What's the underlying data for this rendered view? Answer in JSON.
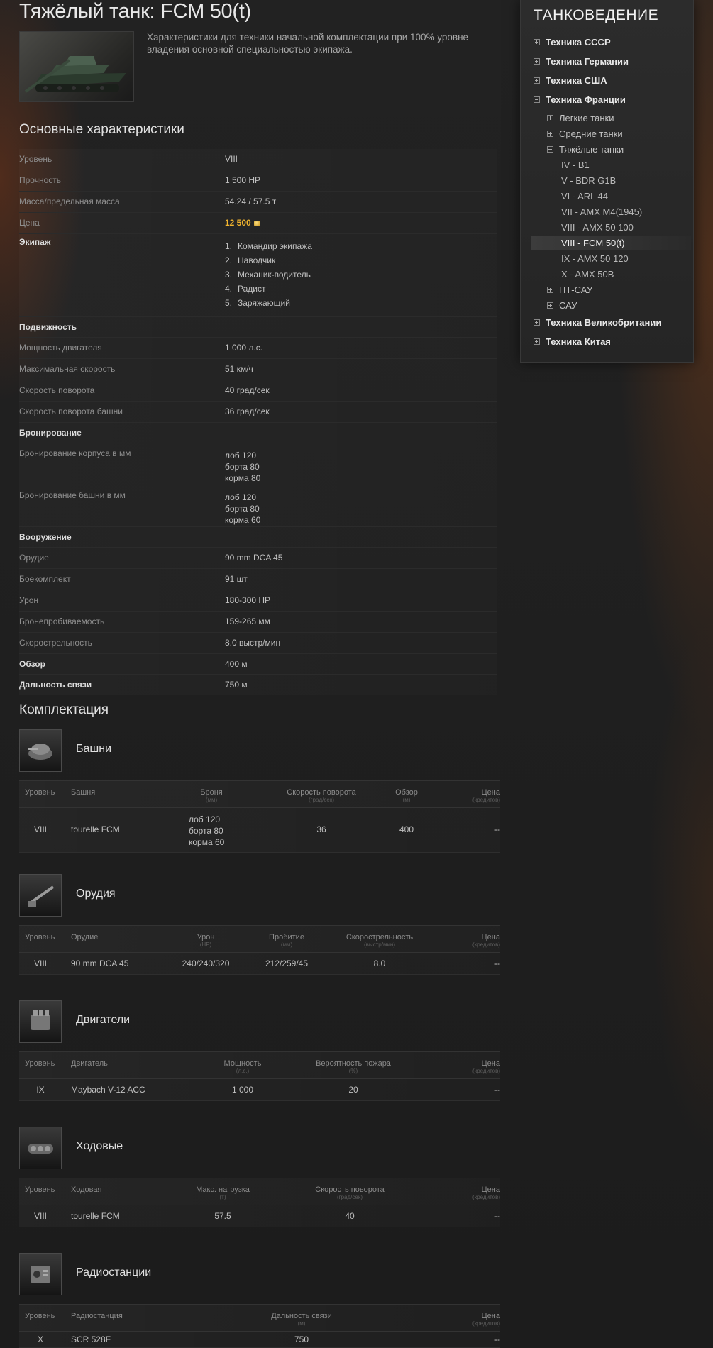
{
  "header": {
    "title": "Тяжёлый танк: FCM 50(t)",
    "description": "Характеристики для техники начальной комплектации при 100% уровне владения основной специальностью экипажа."
  },
  "specs": {
    "section_title": "Основные характеристики",
    "level_label": "Уровень",
    "level_value": "VIII",
    "hp_label": "Прочность",
    "hp_value": "1 500 HP",
    "mass_label": "Масса/предельная масса",
    "mass_value": "54.24 / 57.5 т",
    "price_label": "Цена",
    "price_value": "12 500",
    "crew_label": "Экипаж",
    "crew": [
      {
        "num": "1.",
        "role": "Командир экипажа"
      },
      {
        "num": "2.",
        "role": "Наводчик"
      },
      {
        "num": "3.",
        "role": "Механик-водитель"
      },
      {
        "num": "4.",
        "role": "Радист"
      },
      {
        "num": "5.",
        "role": "Заряжающий"
      }
    ],
    "mobility_label": "Подвижность",
    "engine_power_label": "Мощность двигателя",
    "engine_power_value": "1 000 л.с.",
    "max_speed_label": "Максимальная скорость",
    "max_speed_value": "51 км/ч",
    "traverse_label": "Скорость поворота",
    "traverse_value": "40 град/сек",
    "turret_traverse_label": "Скорость поворота башни",
    "turret_traverse_value": "36 град/сек",
    "armor_label": "Бронирование",
    "hull_armor_label": "Бронирование корпуса в мм",
    "hull_armor": [
      "лоб 120",
      "борта 80",
      "корма 80"
    ],
    "turret_armor_label": "Бронирование башни в мм",
    "turret_armor": [
      "лоб 120",
      "борта 80",
      "корма 60"
    ],
    "armament_label": "Вооружение",
    "gun_label": "Орудие",
    "gun_value": "90 mm DCA 45",
    "ammo_label": "Боекомплект",
    "ammo_value": "91 шт",
    "damage_label": "Урон",
    "damage_value": "180-300 HP",
    "penetration_label": "Бронепробиваемость",
    "penetration_value": "159-265 мм",
    "rof_label": "Скорострельность",
    "rof_value": "8.0 выстр/мин",
    "view_label": "Обзор",
    "view_value": "400 м",
    "radio_range_label": "Дальность связи",
    "radio_range_value": "750 м"
  },
  "equipment": {
    "section_title": "Комплектация",
    "turrets": {
      "title": "Башни",
      "headers": {
        "level": "Уровень",
        "name": "Башня",
        "armor": "Броня",
        "armor_unit": "(мм)",
        "traverse": "Скорость поворота",
        "traverse_unit": "(град/сек)",
        "view": "Обзор",
        "view_unit": "(м)",
        "price": "Цена",
        "price_unit": "(кредитов)"
      },
      "rows": [
        {
          "level": "VIII",
          "name": "tourelle FCM",
          "armor": [
            "лоб 120",
            "борта 80",
            "корма 60"
          ],
          "traverse": "36",
          "view": "400",
          "price": "--"
        }
      ]
    },
    "guns": {
      "title": "Орудия",
      "headers": {
        "level": "Уровень",
        "name": "Орудие",
        "damage": "Урон",
        "damage_unit": "(HP)",
        "penetration": "Пробитие",
        "penetration_unit": "(мм)",
        "rof": "Скорострельность",
        "rof_unit": "(выстр/мин)",
        "price": "Цена",
        "price_unit": "(кредитов)"
      },
      "rows": [
        {
          "level": "VIII",
          "name": "90 mm DCA 45",
          "damage": "240/240/320",
          "penetration": "212/259/45",
          "rof": "8.0",
          "price": "--"
        }
      ]
    },
    "engines": {
      "title": "Двигатели",
      "headers": {
        "level": "Уровень",
        "name": "Двигатель",
        "power": "Мощность",
        "power_unit": "(л.с.)",
        "fire": "Вероятность пожара",
        "fire_unit": "(%)",
        "price": "Цена",
        "price_unit": "(кредитов)"
      },
      "rows": [
        {
          "level": "IX",
          "name": "Maybach V-12 ACC",
          "power": "1 000",
          "fire": "20",
          "price": "--"
        }
      ]
    },
    "suspensions": {
      "title": "Ходовые",
      "headers": {
        "level": "Уровень",
        "name": "Ходовая",
        "load": "Макс. нагрузка",
        "load_unit": "(т)",
        "traverse": "Скорость поворота",
        "traverse_unit": "(град/сек)",
        "price": "Цена",
        "price_unit": "(кредитов)"
      },
      "rows": [
        {
          "level": "VIII",
          "name": "tourelle FCM",
          "load": "57.5",
          "traverse": "40",
          "price": "--"
        }
      ]
    },
    "radios": {
      "title": "Радиостанции",
      "headers": {
        "level": "Уровень",
        "name": "Радиостанция",
        "range": "Дальность связи",
        "range_unit": "(м)",
        "price": "Цена",
        "price_unit": "(кредитов)"
      },
      "rows": [
        {
          "level": "X",
          "name": "SCR 528F",
          "range": "750",
          "price": "--"
        }
      ]
    }
  },
  "sidebar": {
    "title": "ТАНКОВЕДЕНИЕ",
    "items": [
      {
        "label": "Техника СССР",
        "icon": "plus-icon"
      },
      {
        "label": "Техника Германии",
        "icon": "plus-icon"
      },
      {
        "label": "Техника США",
        "icon": "plus-icon"
      },
      {
        "label": "Техника Франции",
        "icon": "minus-icon"
      },
      {
        "label": "Легкие танки",
        "icon": "plus-icon"
      },
      {
        "label": "Средние танки",
        "icon": "plus-icon"
      },
      {
        "label": "Тяжёлые танки",
        "icon": "minus-icon"
      },
      {
        "label": "IV - B1"
      },
      {
        "label": "V - BDR G1B"
      },
      {
        "label": "VI - ARL 44"
      },
      {
        "label": "VII - AMX M4(1945)"
      },
      {
        "label": "VIII - AMX 50 100"
      },
      {
        "label": "VIII - FCM 50(t)",
        "active": true
      },
      {
        "label": "IX - AMX 50 120"
      },
      {
        "label": "X - AMX 50B"
      },
      {
        "label": "ПТ-САУ",
        "icon": "plus-icon"
      },
      {
        "label": "САУ",
        "icon": "plus-icon"
      },
      {
        "label": "Техника Великобритании",
        "icon": "plus-icon"
      },
      {
        "label": "Техника Китая",
        "icon": "plus-icon"
      }
    ]
  },
  "colors": {
    "background": "#1d1d1d",
    "price_gold": "#f1b42e",
    "accent_glow": "#963c14"
  }
}
